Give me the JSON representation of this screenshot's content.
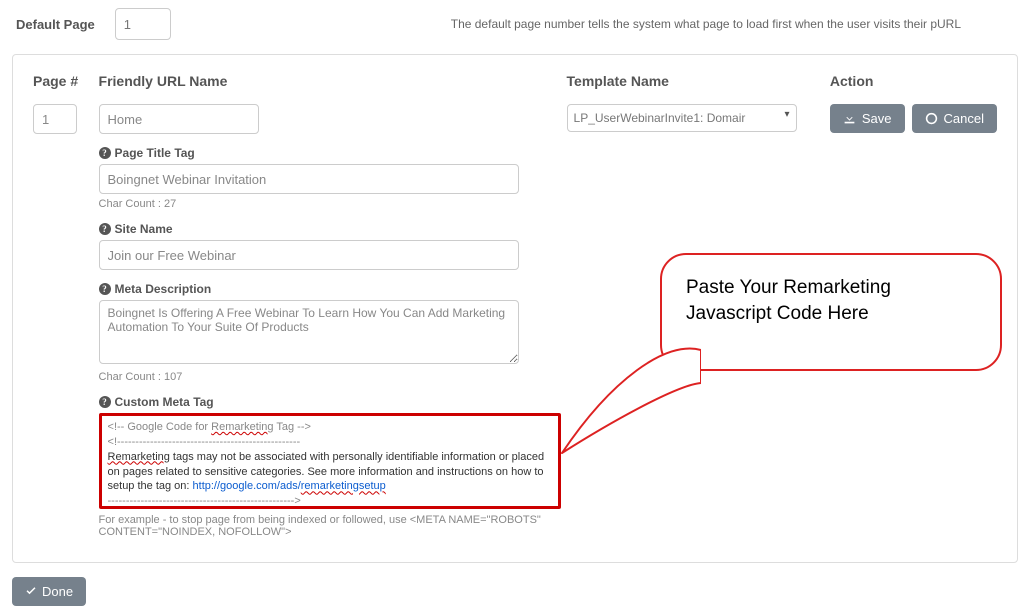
{
  "top": {
    "label": "Default Page",
    "value": "1",
    "description": "The default page number tells the system what page to load first when the user visits their pURL"
  },
  "headers": {
    "page": "Page #",
    "url": "Friendly URL Name",
    "template": "Template Name",
    "action": "Action"
  },
  "row": {
    "page_number": "1",
    "friendly_url": "Home",
    "template_selected": "LP_UserWebinarInvite1: Domair"
  },
  "page_title": {
    "label": "Page Title Tag",
    "value": "Boingnet Webinar Invitation",
    "count_label": "Char Count :",
    "count": "27"
  },
  "site_name": {
    "label": "Site Name",
    "value": "Join our Free Webinar"
  },
  "meta_desc": {
    "label": "Meta Description",
    "value": "Boingnet Is Offering A Free Webinar To Learn How You Can Add Marketing Automation To Your Suite Of Products",
    "count_label": "Char Count :",
    "count": "107"
  },
  "custom_meta": {
    "label": "Custom Meta Tag",
    "line1a": "<!-- Google Code for ",
    "line1b": "Remarketing",
    "line1c": " Tag -->",
    "dashes": "<!--------------------------------------------------",
    "line3a": "Remarketing",
    "line3b": " tags may not be associated with personally identifiable information or placed on pages related to sensitive categories. See more information and instructions on how to setup the tag on: ",
    "link_text": "http://google.com/ads/",
    "link_tail": "remarketingsetup",
    "close_dashes": "--------------------------------------------------->",
    "note": "For example - to stop page from being indexed or followed, use <META NAME=\"ROBOTS\" CONTENT=\"NOINDEX, NOFOLLOW\">"
  },
  "buttons": {
    "save": "Save",
    "cancel": "Cancel",
    "done": "Done"
  },
  "callout": {
    "line1": "Paste Your Remarketing",
    "line2": "Javascript Code Here"
  }
}
